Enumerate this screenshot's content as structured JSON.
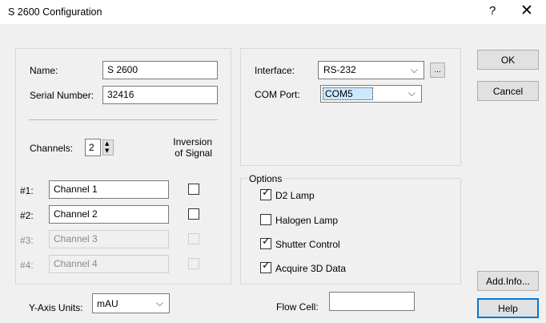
{
  "window": {
    "title": "S 2600 Configuration",
    "help_symbol": "?",
    "close_symbol": "✕"
  },
  "instrument": {
    "name_label": "Name:",
    "name_value": "S 2600",
    "serial_label": "Serial Number:",
    "serial_value": "32416",
    "channels_label": "Channels:",
    "channels_value": "2",
    "inversion_line1": "Inversion",
    "inversion_line2": "of Signal",
    "channels": [
      {
        "label": "#1:",
        "value": "Channel 1",
        "enabled": true,
        "inverted": false
      },
      {
        "label": "#2:",
        "value": "Channel 2",
        "enabled": true,
        "inverted": false
      },
      {
        "label": "#3:",
        "value": "Channel 3",
        "enabled": false,
        "inverted": false
      },
      {
        "label": "#4:",
        "value": "Channel 4",
        "enabled": false,
        "inverted": false
      }
    ]
  },
  "connection": {
    "interface_label": "Interface:",
    "interface_value": "RS-232",
    "browse_label": "...",
    "com_port_label": "COM Port:",
    "com_port_value": "COM5"
  },
  "options": {
    "group_label": "Options",
    "items": [
      {
        "label": "D2 Lamp",
        "checked": true
      },
      {
        "label": "Halogen Lamp",
        "checked": false
      },
      {
        "label": "Shutter Control",
        "checked": true
      },
      {
        "label": "Acquire 3D Data",
        "checked": true
      }
    ]
  },
  "bottom": {
    "y_axis_label": "Y-Axis Units:",
    "y_axis_value": "mAU",
    "flow_cell_label": "Flow Cell:",
    "flow_cell_value": ""
  },
  "buttons": {
    "ok": "OK",
    "cancel": "Cancel",
    "add_info": "Add.Info...",
    "help": "Help"
  },
  "colors": {
    "accent": "#0078d7",
    "dialog_bg": "#f0f0f0",
    "titlebar_bg": "#ffffff"
  },
  "icons": {
    "dropdown": "chevron-down-icon",
    "checkmark": "checkmark-icon",
    "spinner": "spinner-arrows-icon"
  }
}
